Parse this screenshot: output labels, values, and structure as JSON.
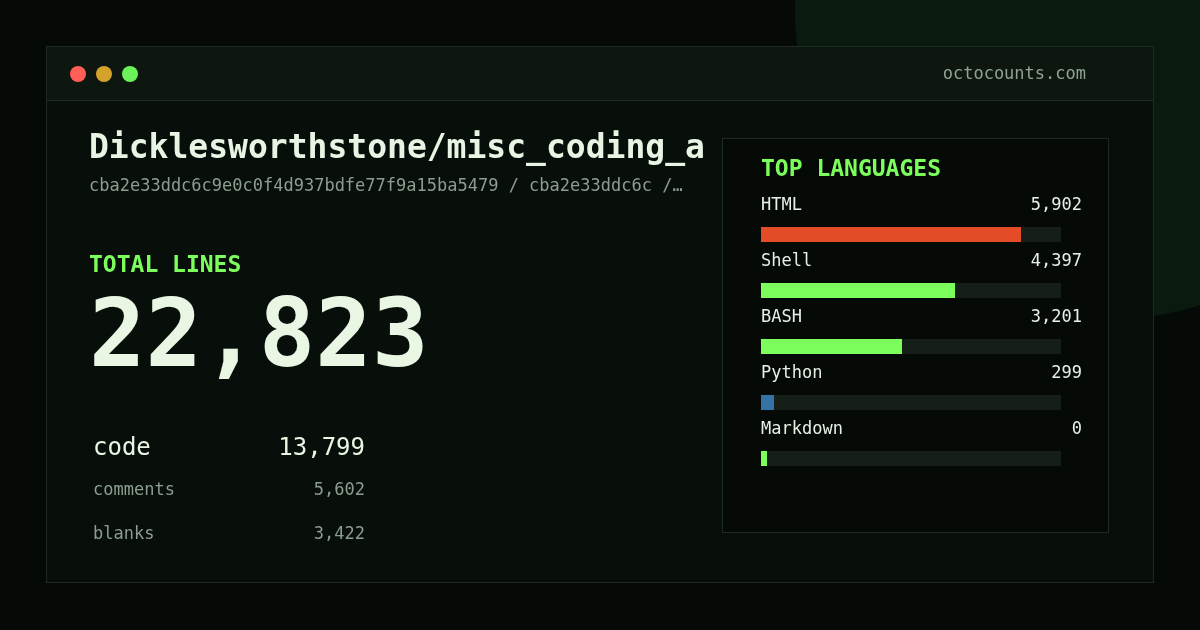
{
  "window": {
    "controls": [
      {
        "color": "#ff5f57"
      },
      {
        "color": "#d4a22b"
      },
      {
        "color": "#6bf25a"
      }
    ],
    "domain": "octocounts.com"
  },
  "repo": {
    "title": "Dicklesworthstone/misc_coding_a",
    "path": "cba2e33ddc6c9e0c0f4d937bdfe77f9a15ba5479 / cba2e33ddc6c /…"
  },
  "total": {
    "label": "TOTAL LINES",
    "value": "22,823"
  },
  "breakdown": [
    {
      "kind": "primary",
      "label": "code",
      "value": "13,799"
    },
    {
      "kind": "secondary",
      "label": "comments",
      "value": "5,602"
    },
    {
      "kind": "secondary",
      "label": "blanks",
      "value": "3,422"
    }
  ],
  "languages": {
    "title": "TOP LANGUAGES",
    "items": [
      {
        "name": "HTML",
        "count": "5,902",
        "level": 0.867,
        "color": "#e34c26"
      },
      {
        "name": "Shell",
        "count": "4,397",
        "level": 0.647,
        "color": "#7cff5c"
      },
      {
        "name": "BASH",
        "count": "3,201",
        "level": 0.47,
        "color": "#7cff5c"
      },
      {
        "name": "Python",
        "count": "299",
        "level": 0.043,
        "color": "#3572a5"
      },
      {
        "name": "Markdown",
        "count": "0",
        "level": 0.02,
        "color": "#7cff5c"
      }
    ]
  }
}
